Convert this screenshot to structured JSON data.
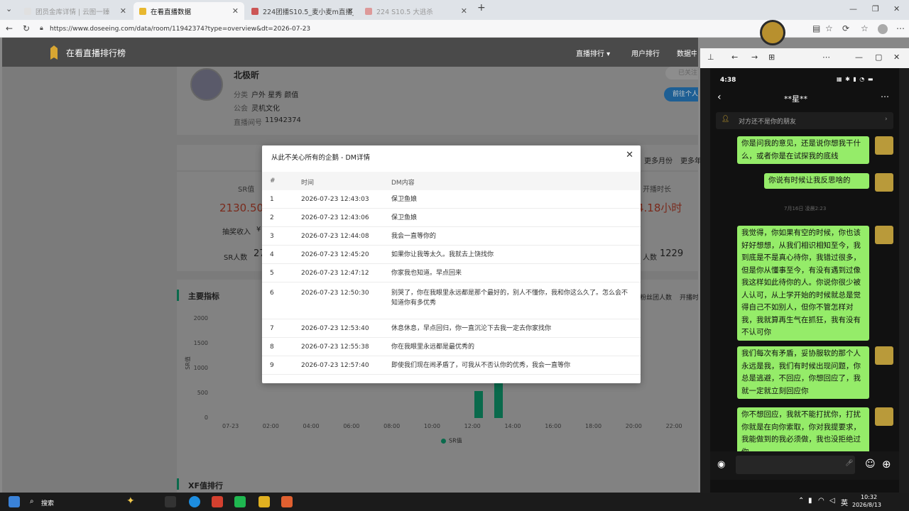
{
  "browser": {
    "tabs": [
      {
        "title": "团员金库详情 | 云图一臻",
        "active": false
      },
      {
        "title": "在看直播数据",
        "active": true
      },
      {
        "title": "224团播S10.5_麦小麦m直播_麦小麦...",
        "active": false
      },
      {
        "title": "224 S10.5 大逃杀",
        "active": false
      }
    ],
    "url": "https://www.doseeing.com/data/room/11942374?type=overview&dt=2026-07-23"
  },
  "site": {
    "title": "在看直播排行榜",
    "nav": [
      "直播排行 ▾",
      "用户排行",
      "数据中心"
    ]
  },
  "profile": {
    "name": "北极昕",
    "category_label": "分类",
    "categories": "户外  星秀  颜值",
    "guild_label": "公会",
    "guild": "灵机文化",
    "room_label": "直播间号",
    "room": "11942374",
    "follow_btn": "已关注",
    "goto_btn": "前往个人"
  },
  "periods": [
    "更多月份",
    "更多年"
  ],
  "stats": {
    "sr_label": "SR值",
    "sr_value": "2130.50万",
    "duration_label": "开播时长",
    "duration_value": "4.18小时",
    "lottery_label": "抽奖收入",
    "lottery_value": "¥",
    "sr_people_label": "SR人数",
    "sr_people_value": "27",
    "people_label": "人数",
    "people_value": "1229"
  },
  "main_metrics": {
    "title": "主要指标",
    "tabs_right": [
      "粉丝团人数",
      "开播时"
    ]
  },
  "chart_data": {
    "type": "bar",
    "ylabel": "SR值",
    "ylim": [
      0,
      2000
    ],
    "yticks": [
      "2000",
      "1500",
      "1000",
      "500",
      "0"
    ],
    "x_ticks": [
      "07-23",
      "02:00",
      "04:00",
      "06:00",
      "08:00",
      "10:00",
      "12:00",
      "14:00",
      "16:00",
      "18:00",
      "20:00",
      "22:00"
    ],
    "categories": [
      "12:00",
      "13:00"
    ],
    "series": [
      {
        "name": "SR值",
        "values": [
          550,
          720
        ]
      }
    ]
  },
  "xf_title": "XF值排行",
  "modal": {
    "title": "从此不关心所有的企鹅 - DM详情",
    "columns": [
      "#",
      "时间",
      "DM内容"
    ],
    "rows": [
      {
        "n": "1",
        "time": "2026-07-23 12:43:03",
        "msg": "保卫鱼娘"
      },
      {
        "n": "2",
        "time": "2026-07-23 12:43:06",
        "msg": "保卫鱼娘"
      },
      {
        "n": "3",
        "time": "2026-07-23 12:44:08",
        "msg": "我会一直等你的"
      },
      {
        "n": "4",
        "time": "2026-07-23 12:45:20",
        "msg": "如果你让我等太久。我就去上饶找你"
      },
      {
        "n": "5",
        "time": "2026-07-23 12:47:12",
        "msg": "你家我也知道。早点回来"
      },
      {
        "n": "6",
        "time": "2026-07-23 12:50:30",
        "msg": "别哭了，你在我眼里永远都是那个最好的，别人不懂你，我和你这么久了。怎么会不知道你有多优秀"
      },
      {
        "n": "7",
        "time": "2026-07-23 12:53:40",
        "msg": "休息休息，早点回归，你一直沉沦下去我一定去你家找你"
      },
      {
        "n": "8",
        "time": "2026-07-23 12:55:38",
        "msg": "你在我眼里永远都是最优秀的"
      },
      {
        "n": "9",
        "time": "2026-07-23 12:57:40",
        "msg": "即使我们现在闹矛盾了，可我从不否认你的优秀，我会一直等你"
      }
    ]
  },
  "phone": {
    "time": "4:38",
    "chat_title": "**星**",
    "notice": "对方还不是你的朋友",
    "timestamp": "7月16日 凌晨2:23",
    "messages": [
      "你是问我的意见，还是说你想我干什么，或者你是在试探我的底线",
      "你说有时候让我反思啥的",
      "我觉得，你如果有空的时候，你也该好好想想，从我们相识相知至今，我到底是不是真心待你，我错过很多，但是你从懂事至今，有没有遇到过像我这样如此待你的人。你说你很少被人认可，从上学开始的时候就总是觉得自己不如别人，但你不管怎样对我，我就算再生气在抓狂，我有没有不认可你",
      "我们每次有矛盾，妥协服软的那个人永远是我，我们有时候出现问题，你总是逃避，不回应，你想回应了，我就一定就立刻回应你",
      "你不想回应，我就不能打扰你，打扰你就是在向你索取，你对我提要求，我能做到的我必须做，我也没拒绝过你"
    ]
  },
  "taskbar": {
    "search": "搜索",
    "lang": "英",
    "time": "10:32",
    "date": "2026/8/13"
  }
}
